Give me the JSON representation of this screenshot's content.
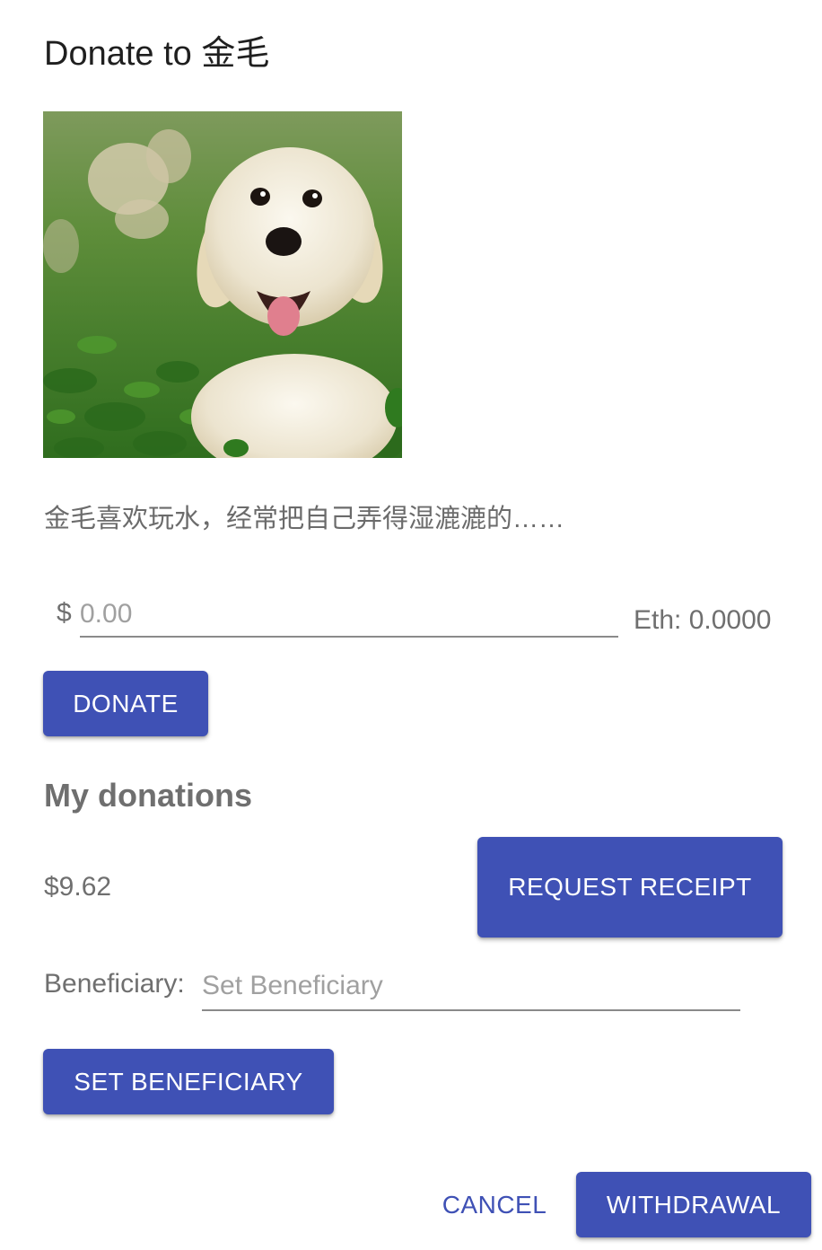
{
  "dialog": {
    "title": "Donate to 金毛",
    "image_alt": "golden retriever puppy",
    "description": "金毛喜欢玩水，经常把自己弄得湿漉漉的……"
  },
  "donation_form": {
    "currency_symbol": "$",
    "amount_placeholder": "0.00",
    "eth_conversion": "Eth: 0.0000",
    "donate_label": "DONATE"
  },
  "my_donations": {
    "heading": "My donations",
    "total": "$9.62",
    "request_receipt_label": "REQUEST RECEIPT"
  },
  "beneficiary": {
    "label": "Beneficiary:",
    "placeholder": "Set Beneficiary",
    "set_label": "SET BENEFICIARY"
  },
  "actions": {
    "cancel_label": "CANCEL",
    "withdraw_label": "WITHDRAWAL"
  },
  "colors": {
    "primary": "#3f51b5",
    "text_muted": "#6f6f6f"
  }
}
